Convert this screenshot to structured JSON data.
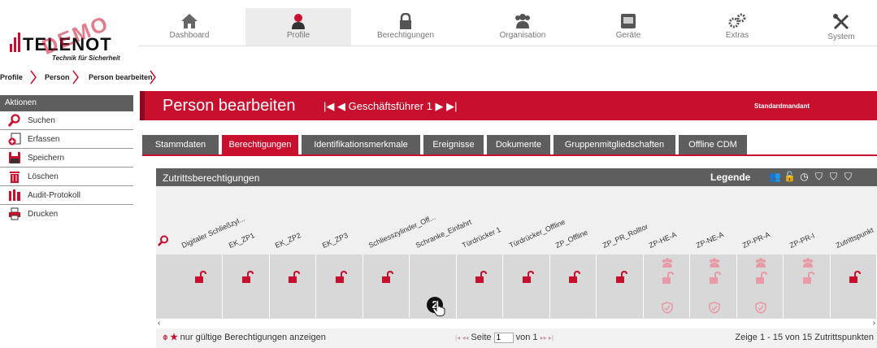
{
  "logo": {
    "brand": "TELENOT",
    "tagline": "Technik für Sicherheit",
    "watermark": "DEMO"
  },
  "nav": [
    {
      "label": "Dashboard",
      "icon": "home-icon"
    },
    {
      "label": "Profile",
      "icon": "profile-icon",
      "active": true
    },
    {
      "label": "Berechtigungen",
      "icon": "lock-icon"
    },
    {
      "label": "Organisation",
      "icon": "group-icon"
    },
    {
      "label": "Geräte",
      "icon": "device-icon"
    },
    {
      "label": "Extras",
      "icon": "gears-icon"
    },
    {
      "label": "System",
      "icon": "tools-icon"
    }
  ],
  "breadcrumb": [
    "Profile",
    "Person",
    "Person bearbeiten"
  ],
  "sidebar": {
    "title": "Aktionen",
    "items": [
      {
        "label": "Suchen",
        "icon": "search-icon"
      },
      {
        "label": "Erfassen",
        "icon": "add-icon"
      },
      {
        "label": "Speichern",
        "icon": "save-icon"
      },
      {
        "label": "Löschen",
        "icon": "trash-icon"
      },
      {
        "label": "Audit-Protokoll",
        "icon": "audit-icon"
      },
      {
        "label": "Drucken",
        "icon": "print-icon"
      }
    ]
  },
  "page": {
    "title": "Person bearbeiten",
    "record_nav": "◀ Geschäftsführer 1 ▶",
    "mandant": "Standardmandant"
  },
  "tabs": [
    {
      "label": "Stammdaten"
    },
    {
      "label": "Berechtigungen",
      "active": true
    },
    {
      "label": "Identifikationsmerkmale"
    },
    {
      "label": "Ereignisse"
    },
    {
      "label": "Dokumente"
    },
    {
      "label": "Gruppenmitgliedschaften"
    },
    {
      "label": "Offline CDM"
    }
  ],
  "zutritt": {
    "title": "Zutrittsberechtigungen",
    "legend_label": "Legende",
    "columns": [
      "Digitaler Schließzyl...",
      "EK_ZP1",
      "EK_ZP2",
      "EK_ZP3",
      "Schliesszylinder_Off...",
      "Schranke_Einfahrt",
      "Türdrücker 1",
      "Türdrücker_Offline",
      "ZP_Offline",
      "ZP_PR_Rolltor",
      "ZP-HE-A",
      "ZP-NE-A",
      "ZP-PR-A",
      "ZP-PR-I",
      "Zutrittspunkt"
    ],
    "overlay_badge": "2"
  },
  "footer": {
    "filter_label": "nur gültige Berechtigungen anzeigen",
    "page_label": "Seite",
    "page_value": "1",
    "of_label": "von 1",
    "summary": "Zeige 1 - 15 von 15 Zutrittspunkten"
  },
  "colors": {
    "accent": "#c8102e",
    "dark": "#5e5e5e"
  }
}
